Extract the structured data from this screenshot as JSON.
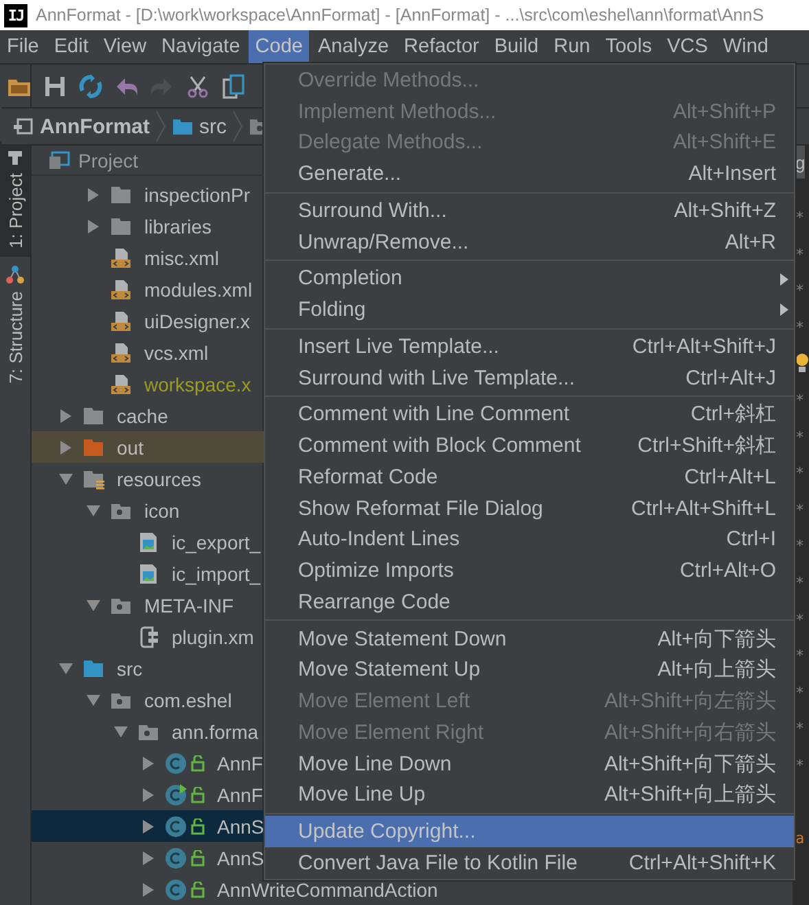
{
  "window": {
    "logo": "IJ",
    "title": "AnnFormat - [D:\\work\\workspace\\AnnFormat] - [AnnFormat] - ...\\src\\com\\eshel\\ann\\format\\AnnS"
  },
  "menubar": [
    {
      "label": "File",
      "selected": false
    },
    {
      "label": "Edit",
      "selected": false
    },
    {
      "label": "View",
      "selected": false
    },
    {
      "label": "Navigate",
      "selected": false
    },
    {
      "label": "Code",
      "selected": true
    },
    {
      "label": "Analyze",
      "selected": false
    },
    {
      "label": "Refactor",
      "selected": false
    },
    {
      "label": "Build",
      "selected": false
    },
    {
      "label": "Run",
      "selected": false
    },
    {
      "label": "Tools",
      "selected": false
    },
    {
      "label": "VCS",
      "selected": false
    },
    {
      "label": "Wind",
      "selected": false
    }
  ],
  "toolbar": [
    {
      "kind": "open",
      "disabled": false
    },
    {
      "kind": "save",
      "disabled": false
    },
    {
      "kind": "sync",
      "disabled": false
    },
    {
      "kind": "undo",
      "disabled": false
    },
    {
      "kind": "redo",
      "disabled": true
    },
    {
      "kind": "cut",
      "disabled": false
    },
    {
      "kind": "copy",
      "disabled": false
    }
  ],
  "breadcrumb": [
    {
      "label": "AnnFormat",
      "kind": "module"
    },
    {
      "label": "src",
      "kind": "source-folder"
    },
    {
      "kind": "package"
    }
  ],
  "side_tabs": [
    {
      "label": "1: Project",
      "kind": "project",
      "selected": true
    },
    {
      "label": "7: Structure",
      "kind": "structure",
      "selected": false
    }
  ],
  "project_panel": {
    "title": "Project",
    "tree": [
      {
        "children": [
          {
            "label": "inspectionPr",
            "kind": "folder",
            "expanded": false,
            "ignored": false,
            "highlighted": false,
            "selected": false
          },
          {
            "label": "libraries",
            "kind": "folder",
            "expanded": false,
            "ignored": false,
            "highlighted": false,
            "selected": false
          },
          {
            "label": "misc.xml",
            "kind": "xml",
            "ignored": false,
            "highlighted": false,
            "selected": false
          },
          {
            "label": "modules.xml",
            "kind": "xml",
            "ignored": false,
            "highlighted": false,
            "selected": false
          },
          {
            "label": "uiDesigner.x",
            "kind": "xml",
            "ignored": false,
            "highlighted": false,
            "selected": false
          },
          {
            "label": "vcs.xml",
            "kind": "xml",
            "ignored": false,
            "highlighted": false,
            "selected": false
          },
          {
            "label": "workspace.x",
            "kind": "xml",
            "ignored": true,
            "highlighted": false,
            "selected": false
          }
        ]
      },
      {
        "label": "cache",
        "kind": "folder",
        "expanded": false,
        "ignored": false,
        "highlighted": false,
        "selected": false
      },
      {
        "label": "out",
        "kind": "excluded-folder",
        "expanded": false,
        "ignored": false,
        "highlighted": true,
        "selected": false
      },
      {
        "label": "resources",
        "kind": "resource-folder",
        "expanded": true,
        "ignored": false,
        "highlighted": false,
        "selected": false,
        "children": [
          {
            "label": "icon",
            "kind": "package",
            "expanded": true,
            "ignored": false,
            "highlighted": false,
            "selected": false,
            "children": [
              {
                "label": "ic_export_",
                "kind": "image",
                "ignored": false,
                "highlighted": false,
                "selected": false
              },
              {
                "label": "ic_import_",
                "kind": "image",
                "ignored": false,
                "highlighted": false,
                "selected": false
              }
            ]
          },
          {
            "label": "META-INF",
            "kind": "package",
            "expanded": true,
            "ignored": false,
            "highlighted": false,
            "selected": false,
            "children": [
              {
                "label": "plugin.xm",
                "kind": "plugin",
                "ignored": false,
                "highlighted": false,
                "selected": false
              }
            ]
          }
        ]
      },
      {
        "label": "src",
        "kind": "source-folder",
        "expanded": true,
        "ignored": false,
        "highlighted": false,
        "selected": false,
        "children": [
          {
            "label": "com.eshel",
            "kind": "package",
            "expanded": true,
            "ignored": false,
            "highlighted": false,
            "selected": false,
            "children": [
              {
                "label": "ann.forma",
                "kind": "package",
                "expanded": true,
                "ignored": false,
                "highlighted": false,
                "selected": false,
                "children": [
                  {
                    "label": "AnnF",
                    "kind": "class",
                    "expanded": false,
                    "runnable": false,
                    "ignored": false,
                    "highlighted": false,
                    "selected": false
                  },
                  {
                    "label": "AnnF",
                    "kind": "class",
                    "expanded": false,
                    "runnable": true,
                    "ignored": false,
                    "highlighted": false,
                    "selected": false
                  },
                  {
                    "label": "AnnS",
                    "kind": "class",
                    "expanded": false,
                    "runnable": false,
                    "ignored": false,
                    "highlighted": false,
                    "selected": true
                  },
                  {
                    "label": "AnnS",
                    "kind": "class",
                    "expanded": false,
                    "runnable": false,
                    "ignored": false,
                    "highlighted": false,
                    "selected": false
                  },
                  {
                    "label": "AnnWriteCommandAction",
                    "kind": "class",
                    "expanded": false,
                    "runnable": false,
                    "ignored": false,
                    "highlighted": false,
                    "selected": false
                  }
                ]
              }
            ]
          }
        ]
      }
    ]
  },
  "editor": {
    "tab": "g",
    "lines": [
      {
        "text": "*",
        "kind": "comment"
      },
      {
        "text": "*",
        "kind": "comment"
      },
      {
        "text": "*",
        "kind": "comment"
      },
      {
        "text": "*",
        "kind": "comment"
      },
      {
        "kind": "bulb"
      },
      {
        "text": "*",
        "kind": "comment"
      },
      {
        "text": "*",
        "kind": "comment"
      },
      {
        "text": "*",
        "kind": "comment"
      },
      {
        "text": "*",
        "kind": "comment"
      },
      {
        "text": "*",
        "kind": "comment"
      },
      {
        "text": "*",
        "kind": "comment"
      },
      {
        "text": "*",
        "kind": "comment"
      },
      {
        "text": "*",
        "kind": "comment"
      },
      {
        "text": "*",
        "kind": "comment"
      },
      {
        "text": "*",
        "kind": "comment"
      },
      {
        "text": "*",
        "kind": "comment"
      },
      {
        "kind": "blank"
      },
      {
        "text": "a",
        "kind": "keyword"
      }
    ]
  },
  "code_menu": [
    {
      "kind": "item",
      "label": "Override Methods...",
      "disabled": true,
      "selected": false,
      "submenu": false
    },
    {
      "kind": "item",
      "label": "Implement Methods...",
      "shortcut": "Alt+Shift+P",
      "disabled": true,
      "selected": false,
      "submenu": false
    },
    {
      "kind": "item",
      "label": "Delegate Methods...",
      "shortcut": "Alt+Shift+E",
      "disabled": true,
      "selected": false,
      "submenu": false
    },
    {
      "kind": "item",
      "label": "Generate...",
      "shortcut": "Alt+Insert",
      "disabled": false,
      "selected": false,
      "submenu": false
    },
    {
      "kind": "separator"
    },
    {
      "kind": "item",
      "label": "Surround With...",
      "shortcut": "Alt+Shift+Z",
      "disabled": false,
      "selected": false,
      "submenu": false
    },
    {
      "kind": "item",
      "label": "Unwrap/Remove...",
      "shortcut": "Alt+R",
      "disabled": false,
      "selected": false,
      "submenu": false
    },
    {
      "kind": "separator"
    },
    {
      "kind": "item",
      "label": "Completion",
      "disabled": false,
      "selected": false,
      "submenu": true
    },
    {
      "kind": "item",
      "label": "Folding",
      "disabled": false,
      "selected": false,
      "submenu": true
    },
    {
      "kind": "separator"
    },
    {
      "kind": "item",
      "label": "Insert Live Template...",
      "shortcut": "Ctrl+Alt+Shift+J",
      "disabled": false,
      "selected": false,
      "submenu": false
    },
    {
      "kind": "item",
      "label": "Surround with Live Template...",
      "shortcut": "Ctrl+Alt+J",
      "disabled": false,
      "selected": false,
      "submenu": false
    },
    {
      "kind": "separator"
    },
    {
      "kind": "item",
      "label": "Comment with Line Comment",
      "shortcut": "Ctrl+斜杠",
      "disabled": false,
      "selected": false,
      "submenu": false
    },
    {
      "kind": "item",
      "label": "Comment with Block Comment",
      "shortcut": "Ctrl+Shift+斜杠",
      "disabled": false,
      "selected": false,
      "submenu": false
    },
    {
      "kind": "item",
      "label": "Reformat Code",
      "shortcut": "Ctrl+Alt+L",
      "disabled": false,
      "selected": false,
      "submenu": false
    },
    {
      "kind": "item",
      "label": "Show Reformat File Dialog",
      "shortcut": "Ctrl+Alt+Shift+L",
      "disabled": false,
      "selected": false,
      "submenu": false
    },
    {
      "kind": "item",
      "label": "Auto-Indent Lines",
      "shortcut": "Ctrl+I",
      "disabled": false,
      "selected": false,
      "submenu": false
    },
    {
      "kind": "item",
      "label": "Optimize Imports",
      "shortcut": "Ctrl+Alt+O",
      "disabled": false,
      "selected": false,
      "submenu": false
    },
    {
      "kind": "item",
      "label": "Rearrange Code",
      "disabled": false,
      "selected": false,
      "submenu": false
    },
    {
      "kind": "separator"
    },
    {
      "kind": "item",
      "label": "Move Statement Down",
      "shortcut": "Alt+向下箭头",
      "disabled": false,
      "selected": false,
      "submenu": false
    },
    {
      "kind": "item",
      "label": "Move Statement Up",
      "shortcut": "Alt+向上箭头",
      "disabled": false,
      "selected": false,
      "submenu": false
    },
    {
      "kind": "item",
      "label": "Move Element Left",
      "shortcut": "Alt+Shift+向左箭头",
      "disabled": true,
      "selected": false,
      "submenu": false
    },
    {
      "kind": "item",
      "label": "Move Element Right",
      "shortcut": "Alt+Shift+向右箭头",
      "disabled": true,
      "selected": false,
      "submenu": false
    },
    {
      "kind": "item",
      "label": "Move Line Down",
      "shortcut": "Alt+Shift+向下箭头",
      "disabled": false,
      "selected": false,
      "submenu": false
    },
    {
      "kind": "item",
      "label": "Move Line Up",
      "shortcut": "Alt+Shift+向上箭头",
      "disabled": false,
      "selected": false,
      "submenu": false
    },
    {
      "kind": "separator"
    },
    {
      "kind": "item",
      "label": "Update Copyright...",
      "disabled": false,
      "selected": true,
      "submenu": false
    },
    {
      "kind": "item",
      "label": "Convert Java File to Kotlin File",
      "shortcut": "Ctrl+Alt+Shift+K",
      "disabled": false,
      "selected": false,
      "submenu": false
    }
  ]
}
